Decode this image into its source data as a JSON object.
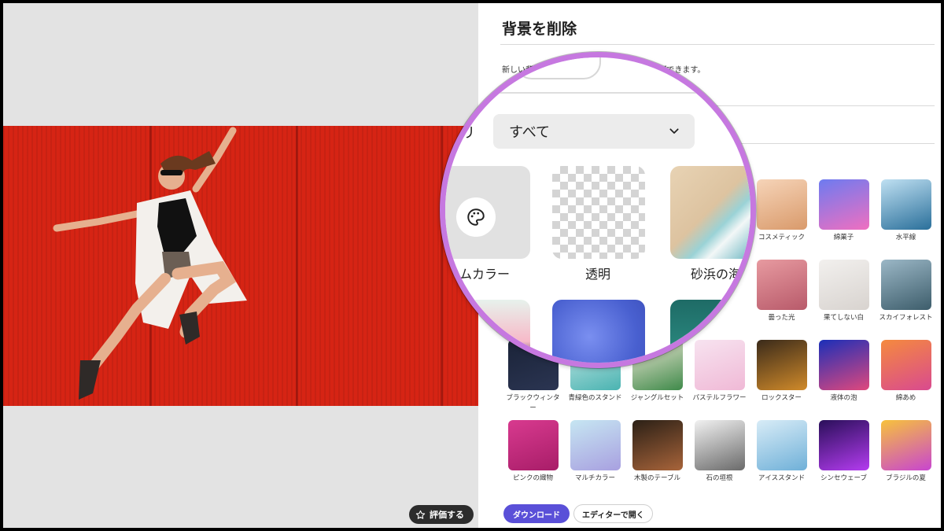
{
  "panel": {
    "title": "背景を削除",
    "description": "新しい背景を追加してカスタマイズすることができます。"
  },
  "magnifier": {
    "category_label": "リ",
    "category_select": "すべて",
    "items": [
      {
        "label": "タムカラー"
      },
      {
        "label": "透明"
      },
      {
        "label": "砂浜の海"
      }
    ]
  },
  "backgrounds": [
    {
      "label": "",
      "icon": "empty"
    },
    {
      "label": "",
      "icon": "empty"
    },
    {
      "label": "",
      "icon": "empty"
    },
    {
      "label": "",
      "icon": "empty"
    },
    {
      "label": "コスメティック",
      "colors": [
        "#f6d4b8",
        "#d99a6b"
      ]
    },
    {
      "label": "綿菓子",
      "colors": [
        "#6d7bf0",
        "#f06fc0"
      ]
    },
    {
      "label": "水平線",
      "colors": [
        "#bfe0f2",
        "#2a6f9a"
      ]
    },
    {
      "label": "",
      "icon": "empty"
    },
    {
      "label": "",
      "icon": "empty"
    },
    {
      "label": "",
      "icon": "empty"
    },
    {
      "label": "",
      "icon": "empty"
    },
    {
      "label": "曇った光",
      "colors": [
        "#e79aa0",
        "#b85a6a"
      ]
    },
    {
      "label": "果てしない白",
      "colors": [
        "#f2f0ee",
        "#d8d3cf"
      ]
    },
    {
      "label": "スカイフォレスト",
      "colors": [
        "#9bb7c6",
        "#3d5d6b"
      ]
    },
    {
      "label": "ブラックウィンター",
      "colors": [
        "#1a2338",
        "#2b3552"
      ]
    },
    {
      "label": "青緑色のスタンド",
      "colors": [
        "#c6e8e6",
        "#4ab3b1"
      ]
    },
    {
      "label": "ジャングルセット",
      "colors": [
        "#f2e9d8",
        "#3f8a4a"
      ]
    },
    {
      "label": "パステルフラワー",
      "colors": [
        "#f7e3f0",
        "#f0b9d6"
      ]
    },
    {
      "label": "ロックスター",
      "colors": [
        "#3a2a1a",
        "#d08a2a"
      ]
    },
    {
      "label": "液体の泡",
      "colors": [
        "#1b2fb8",
        "#e0487d"
      ]
    },
    {
      "label": "綿あめ",
      "colors": [
        "#f58a3e",
        "#d94a8f"
      ]
    },
    {
      "label": "ピンクの織物",
      "colors": [
        "#d83a8f",
        "#a81d68"
      ]
    },
    {
      "label": "マルチカラー",
      "colors": [
        "#c6e6f2",
        "#a8a0e0"
      ]
    },
    {
      "label": "木製のテーブル",
      "colors": [
        "#2b2016",
        "#a8643a"
      ]
    },
    {
      "label": "石の垣根",
      "colors": [
        "#f1f1f1",
        "#6a6a6a"
      ]
    },
    {
      "label": "アイススタンド",
      "colors": [
        "#d8ecf7",
        "#6fb0d8"
      ]
    },
    {
      "label": "シンセウェーブ",
      "colors": [
        "#2a0f5a",
        "#b43cf0"
      ]
    },
    {
      "label": "ブラジルの夏",
      "colors": [
        "#f7c23c",
        "#c845d0"
      ]
    }
  ],
  "actions": {
    "download": "ダウンロード",
    "open_editor": "エディターで開く",
    "rate": "評価する"
  },
  "colors": {
    "accent": "#5a50d8",
    "magnifier_ring": "#c678e0",
    "photo_background": "#d62414"
  }
}
